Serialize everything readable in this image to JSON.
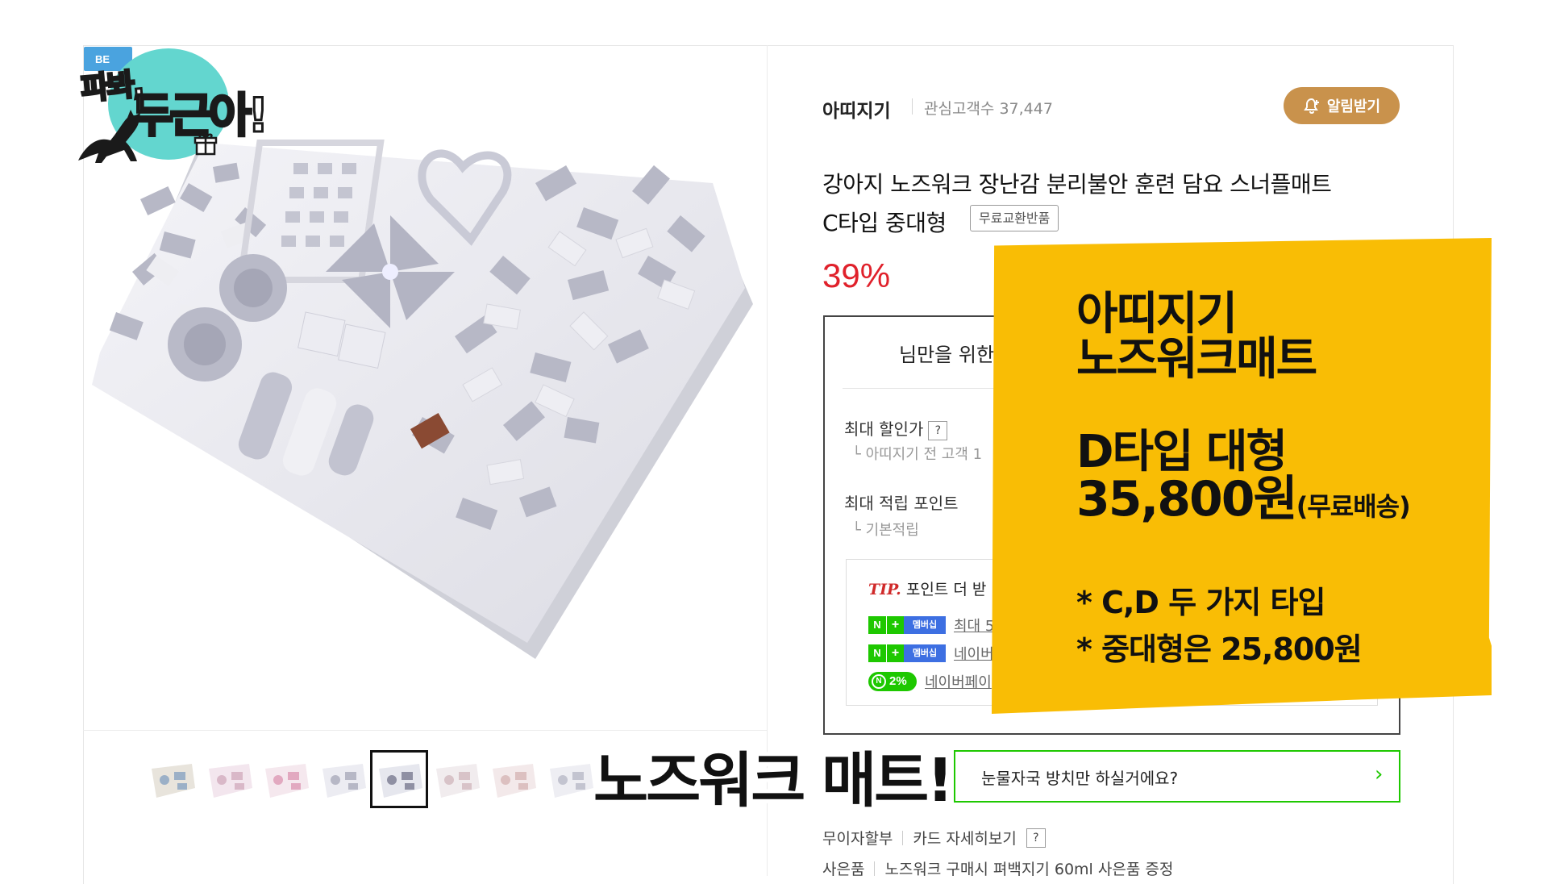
{
  "logo": {
    "badge": "BE",
    "line1": "파봐,",
    "line2": "두근아!"
  },
  "store": {
    "name": "아띠지기",
    "interest_label": "관심고객수 37,447",
    "alert_label": "알림받기"
  },
  "product": {
    "title_line1": "강아지 노즈워크 장난감 분리불안 훈련 담요 스너플매트",
    "title_line2": "C타입 중대형",
    "free_return_badge": "무료교환반품",
    "discount": "39%"
  },
  "benefits": {
    "title": "님만을 위한",
    "max_discount_label": "최대 할인가",
    "max_discount_sub": "아띠지기 전 고객 1",
    "max_points_label": "최대 적립 포인트",
    "max_points_sub": "기본적립",
    "help_glyph": "?",
    "tip_label": "TIP.",
    "tip_text": "포인트 더 받",
    "npay_rows": [
      {
        "badge_n": "N",
        "badge_plus": "+",
        "badge_member": "멤버십",
        "text": "최대 5"
      },
      {
        "badge_n": "N",
        "badge_plus": "+",
        "badge_member": "멤버십",
        "text": "네이버"
      }
    ],
    "pct_row": {
      "badge_icon": "N",
      "badge_value": "2%",
      "text": "네이버페이"
    }
  },
  "cta": {
    "text": "눈물자국 방치만 하실거에요?",
    "arrow": "›"
  },
  "footer": {
    "installment": "무이자할부",
    "card_detail": "카드 자세히보기",
    "gift_label": "사은품",
    "gift_text": "노즈워크 구매시 펴백지기 60ml 사은품 증정"
  },
  "sticky_note": {
    "line1": "아띠지기",
    "line2": "노즈워크매트",
    "line3": "D타입 대형",
    "price": "35,800원",
    "price_note": "(무료배송)",
    "bullet1": "* C,D 두 가지 타입",
    "bullet2": "* 중대형은 25,800원"
  },
  "caption": "노즈워크 매트!",
  "thumbnails": [
    {
      "name": "thumb-1"
    },
    {
      "name": "thumb-2"
    },
    {
      "name": "thumb-3"
    },
    {
      "name": "thumb-4"
    },
    {
      "name": "thumb-5"
    },
    {
      "name": "thumb-6"
    },
    {
      "name": "thumb-7"
    },
    {
      "name": "thumb-8"
    }
  ],
  "selected_thumbnail": 5,
  "colors": {
    "discount_red": "#e0212b",
    "alert_brown": "#c9924c",
    "sticky_yellow": "#f9bd05",
    "naver_green": "#1ec800"
  }
}
